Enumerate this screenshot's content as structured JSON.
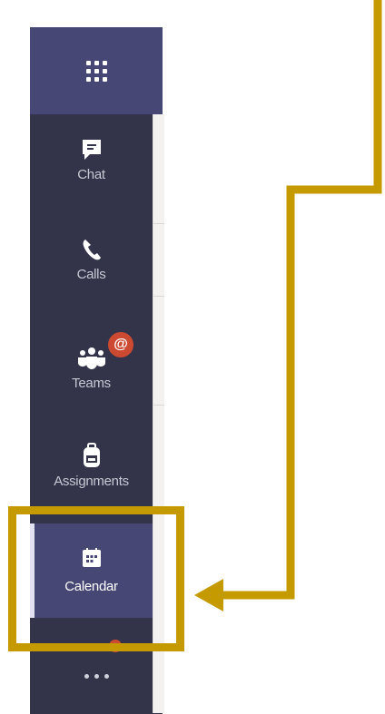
{
  "nav": {
    "items": [
      {
        "label": "Chat",
        "icon": "chat-icon"
      },
      {
        "label": "Calls",
        "icon": "phone-icon"
      },
      {
        "label": "Teams",
        "icon": "teams-icon",
        "badge": "@"
      },
      {
        "label": "Assignments",
        "icon": "backpack-icon"
      },
      {
        "label": "Calendar",
        "icon": "calendar-icon",
        "active": true
      }
    ],
    "more_icon": "more-icon",
    "app_launcher_icon": "waffle-icon"
  },
  "annotation": {
    "highlight_color": "#c59a00",
    "target": "Calendar"
  },
  "colors": {
    "rail": "#33344a",
    "active": "#464775",
    "badge": "#cc4a31"
  }
}
